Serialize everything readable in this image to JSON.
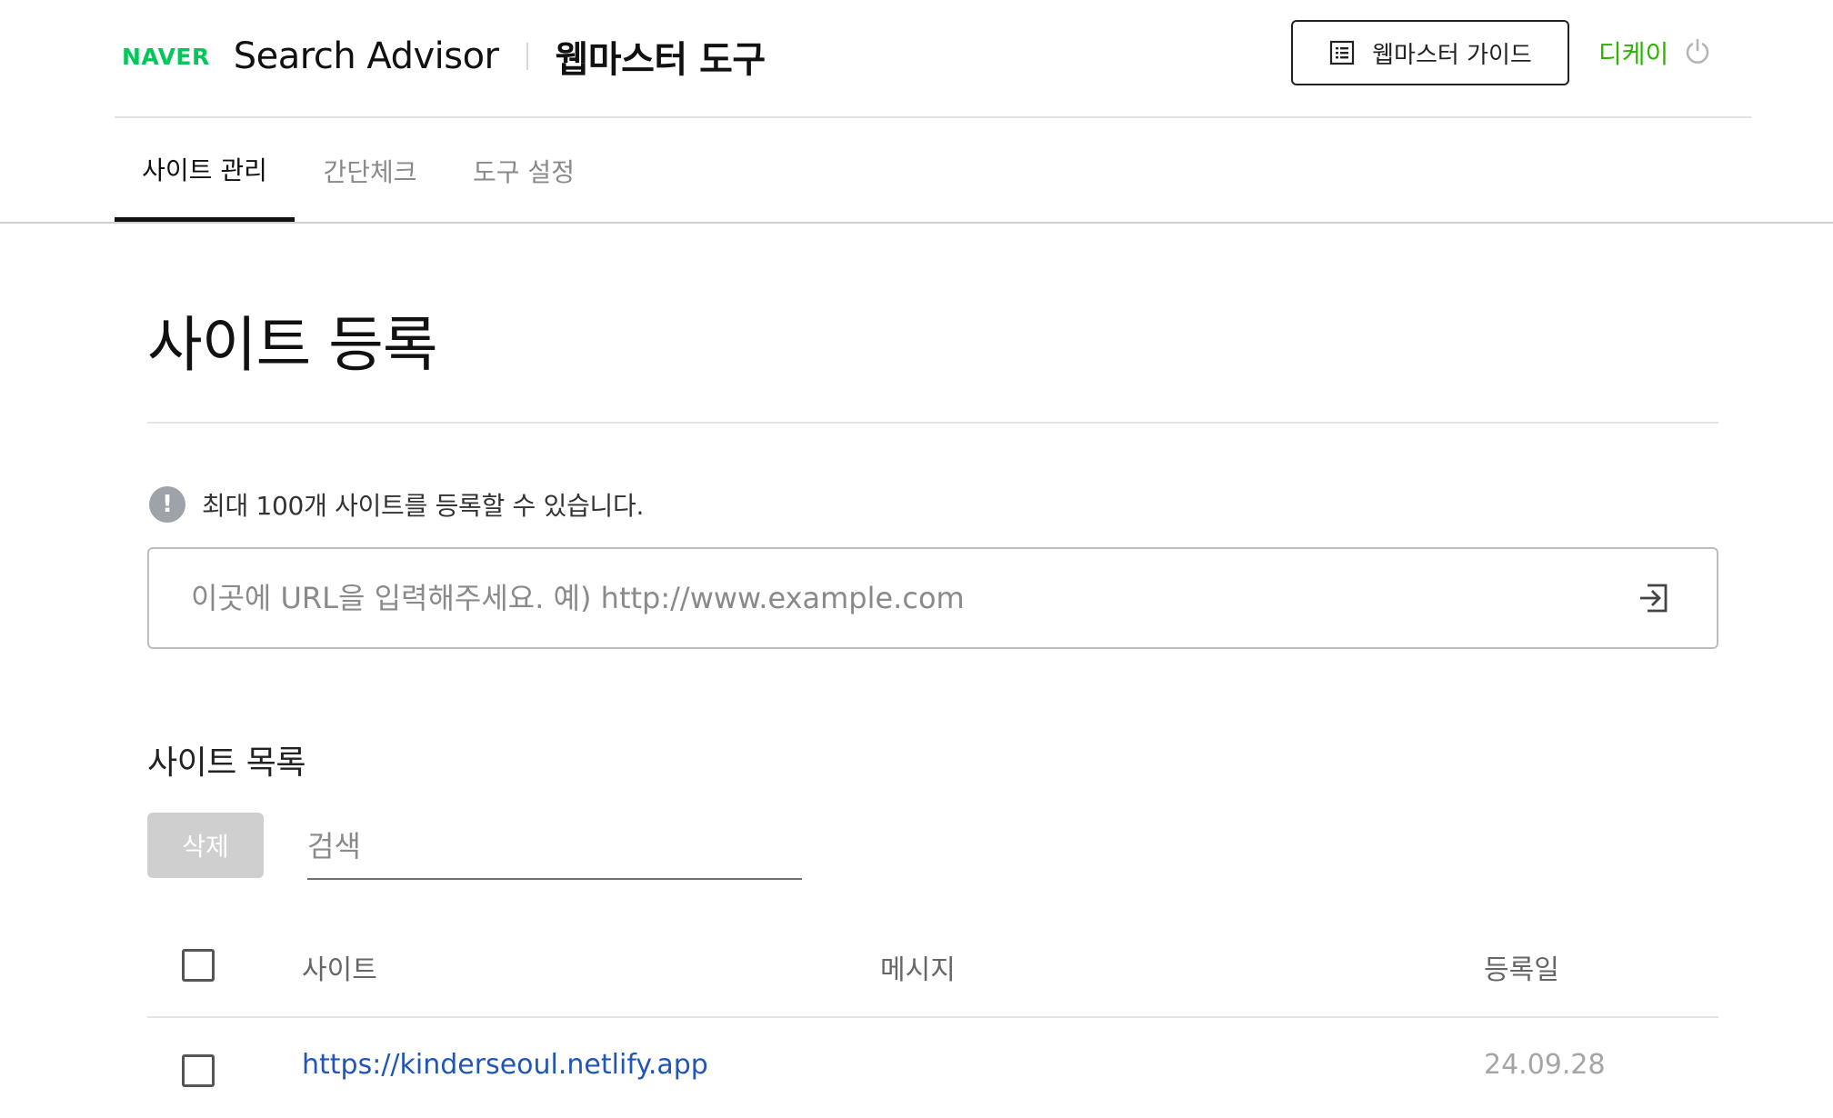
{
  "header": {
    "logo_text": "NAVER",
    "app_title": "Search Advisor",
    "section_title": "웹마스터 도구",
    "guide_button_label": "웹마스터 가이드",
    "guide_icon": "list-document-icon",
    "user_name": "디케이",
    "power_icon": "power-icon",
    "accent_color": "#2db400"
  },
  "tabs": [
    {
      "label": "사이트 관리",
      "active": true
    },
    {
      "label": "간단체크",
      "active": false
    },
    {
      "label": "도구 설정",
      "active": false
    }
  ],
  "main": {
    "heading": "사이트 등록",
    "notice_icon": "exclamation-circle-icon",
    "notice_text": "최대 100개 사이트를 등록할 수 있습니다.",
    "url_input": {
      "value": "",
      "placeholder": "이곳에 URL을 입력해주세요. 예) http://www.example.com"
    },
    "submit_icon": "enter-arrow-icon",
    "list_title": "사이트 목록",
    "delete_button_label": "삭제",
    "search_input": {
      "value": "",
      "placeholder": "검색"
    }
  },
  "table": {
    "columns": [
      "사이트",
      "메시지",
      "등록일"
    ],
    "rows": [
      {
        "site": "https://kinderseoul.netlify.app",
        "message": "",
        "date": "24.09.28",
        "checked": false
      }
    ],
    "link_color": "#2156b8"
  }
}
